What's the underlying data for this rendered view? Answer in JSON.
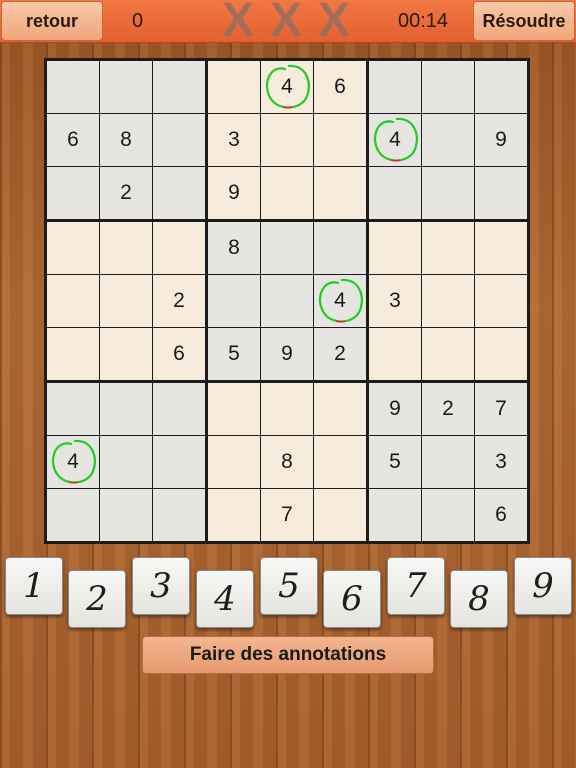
{
  "topbar": {
    "back_label": "retour",
    "score": "0",
    "mistake_marks": [
      "X",
      "X",
      "X"
    ],
    "timer": "00:14",
    "solve_label": "Résoudre"
  },
  "board": {
    "grid": [
      [
        "",
        "",
        "",
        "",
        "4",
        "6",
        "",
        "",
        ""
      ],
      [
        "6",
        "8",
        "",
        "3",
        "",
        "",
        "4",
        "",
        "9"
      ],
      [
        "",
        "2",
        "",
        "9",
        "",
        "",
        "",
        "",
        ""
      ],
      [
        "",
        "",
        "",
        "8",
        "",
        "",
        "",
        "",
        ""
      ],
      [
        "",
        "",
        "2",
        "",
        "",
        "4",
        "3",
        "",
        ""
      ],
      [
        "",
        "",
        "6",
        "5",
        "9",
        "2",
        "",
        "",
        ""
      ],
      [
        "",
        "",
        "",
        "",
        "",
        "",
        "9",
        "2",
        "7"
      ],
      [
        "4",
        "",
        "",
        "",
        "8",
        "",
        "5",
        "",
        "3"
      ],
      [
        "",
        "",
        "",
        "",
        "7",
        "",
        "",
        "",
        "6"
      ]
    ],
    "highlighted_digit": "4",
    "highlight_color": "#22cc22",
    "box_colors": {
      "grey": "#e7e5e1",
      "cream": "#f7ecdc"
    }
  },
  "numpad": {
    "keys": [
      "1",
      "2",
      "3",
      "4",
      "5",
      "6",
      "7",
      "8",
      "9"
    ]
  },
  "annotate_label": "Faire des annotations"
}
